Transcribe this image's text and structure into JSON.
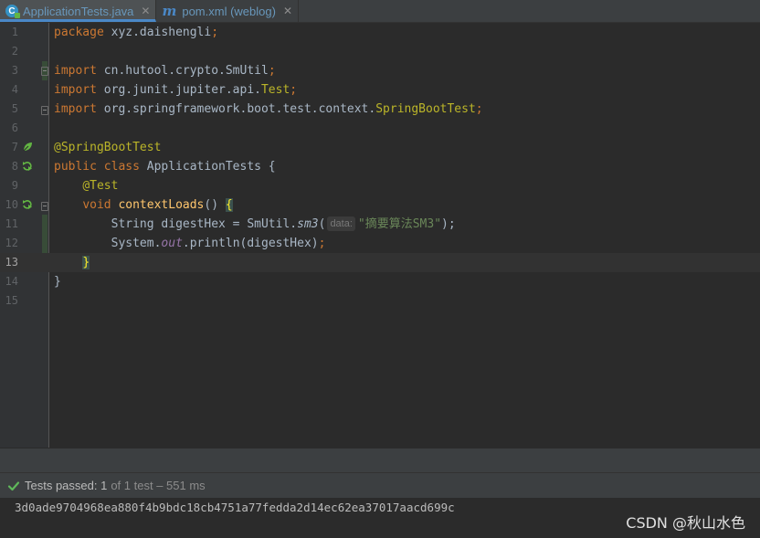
{
  "tabs": [
    {
      "label": "ApplicationTests.java",
      "icon": "java-class-icon",
      "active": true
    },
    {
      "label": "pom.xml (weblog)",
      "icon": "maven-icon",
      "active": false
    }
  ],
  "editor": {
    "line_numbers": [
      "1",
      "2",
      "3",
      "4",
      "5",
      "6",
      "7",
      "8",
      "9",
      "10",
      "11",
      "12",
      "13",
      "14",
      "15"
    ],
    "current_line": 13,
    "code": {
      "l1_kw": "package",
      "l1_rest": " xyz.daishengli",
      "l1_semi": ";",
      "l3_kw": "import",
      "l3_rest": " cn.hutool.crypto.SmUtil",
      "l3_semi": ";",
      "l4_kw": "import",
      "l4_rest": " org.junit.jupiter.api.",
      "l4_cls": "Test",
      "l4_semi": ";",
      "l5_kw": "import",
      "l5_rest": " org.springframework.boot.test.context.",
      "l5_cls": "SpringBootTest",
      "l5_semi": ";",
      "l7_ann": "@SpringBootTest",
      "l8_kw": "public class",
      "l8_rest": " ApplicationTests {",
      "l9_indent": "    ",
      "l9_ann": "@Test",
      "l10_indent": "    ",
      "l10_kw": "void",
      "l10_method": " contextLoads",
      "l10_paren": "() ",
      "l10_brace": "{",
      "l11_indent": "        ",
      "l11_text": "String digestHex = SmUtil.",
      "l11_call": "sm3",
      "l11_open": "(",
      "l11_hint": "data:",
      "l11_str": "\"摘要算法SM3\"",
      "l11_close": ");",
      "l12_indent": "        ",
      "l12_a": "System.",
      "l12_out": "out",
      "l12_b": ".println(digestHex)",
      "l12_semi": ";",
      "l13_indent": "    ",
      "l13_brace": "}",
      "l14": "}"
    }
  },
  "test_panel": {
    "status_main": "Tests passed: 1",
    "status_sub": "of 1 test – 551 ms",
    "output": "3d0ade9704968ea880f4b9bdc18cb4751a77fedda2d14ec62ea37017aacd699c"
  },
  "watermark": "CSDN @秋山水色",
  "colors": {
    "background": "#2b2b2b",
    "keyword": "#cc7832",
    "annotation": "#bbb529",
    "string": "#6a8759",
    "pass_green": "#5fb85a"
  }
}
